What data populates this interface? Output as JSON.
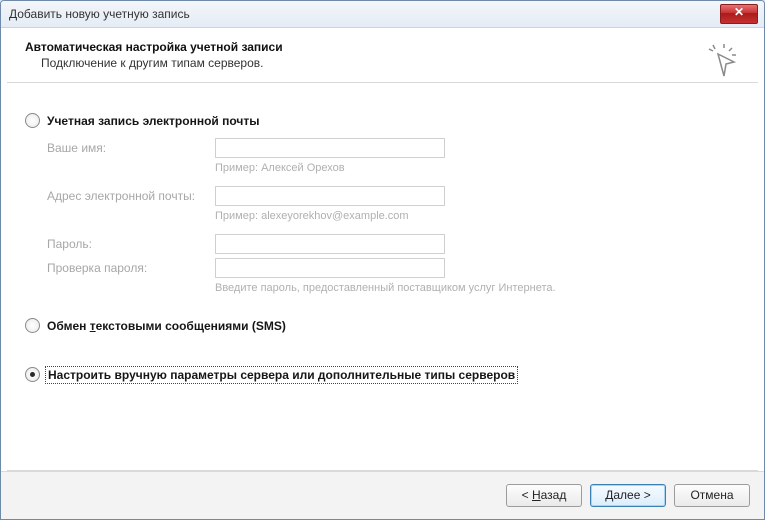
{
  "window": {
    "title": "Добавить новую учетную запись"
  },
  "header": {
    "title": "Автоматическая настройка учетной записи",
    "subtitle": "Подключение к другим типам серверов."
  },
  "options": {
    "email": "Учетная запись электронной почты",
    "sms_prefix": "Обмен ",
    "sms_ul": "т",
    "sms_suffix": "екстовыми сообщениями (SMS)",
    "manual": "Настроить вручную параметры сервера или дополнительные типы серверов"
  },
  "form": {
    "name_label": "Ваше имя:",
    "name_hint": "Пример: Алексей Орехов",
    "email_label": "Адрес электронной почты:",
    "email_hint": "Пример: alexeyorekhov@example.com",
    "password_label": "Пароль:",
    "confirm_label": "Проверка пароля:",
    "password_hint": "Введите пароль, предоставленный поставщиком услуг Интернета."
  },
  "buttons": {
    "back_prefix": "< ",
    "back_ul": "Н",
    "back_suffix": "азад",
    "next_ul": "Д",
    "next_suffix": "алее >",
    "cancel": "Отмена"
  }
}
